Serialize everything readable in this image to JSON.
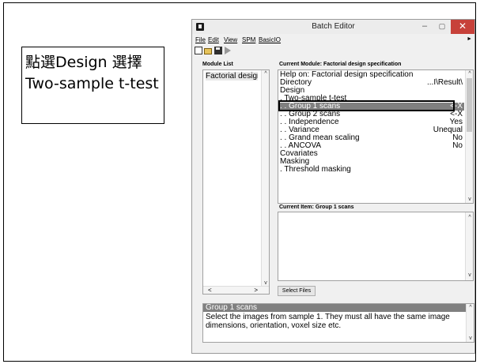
{
  "callout": {
    "text": "點選Design 選擇 Two-sample t-test"
  },
  "window": {
    "title": "Batch Editor",
    "menu": [
      "File",
      "Edit",
      "View",
      "SPM",
      "BasicIO"
    ],
    "module_list_label": "Module List",
    "current_module_label": "Current Module: Factorial design specification",
    "modules": [
      "Factorial design"
    ],
    "tree": [
      {
        "label": "Help on: Factorial design specification",
        "value": ""
      },
      {
        "label": "Directory",
        "value": "...I\\Result\\"
      },
      {
        "label": "Design",
        "value": ""
      },
      {
        "label": ". Two-sample t-test",
        "value": ""
      },
      {
        "label": ". . Group 1 scans",
        "value": "<-X",
        "selected": true
      },
      {
        "label": ". . Group 2 scans",
        "value": "<-X"
      },
      {
        "label": ". . Independence",
        "value": "Yes"
      },
      {
        "label": ". . Variance",
        "value": "Unequal"
      },
      {
        "label": ". . Grand mean scaling",
        "value": "No"
      },
      {
        "label": ". . ANCOVA",
        "value": "No"
      },
      {
        "label": "Covariates",
        "value": ""
      },
      {
        "label": "Masking",
        "value": ""
      },
      {
        "label": ". Threshold masking",
        "value": ""
      }
    ],
    "current_item_label": "Current Item: Group 1 scans",
    "select_files_label": "Select Files",
    "help_title": "Group 1 scans",
    "help_text": "Select the images from sample 1. They must all have the same image dimensions, orientation, voxel size etc."
  }
}
